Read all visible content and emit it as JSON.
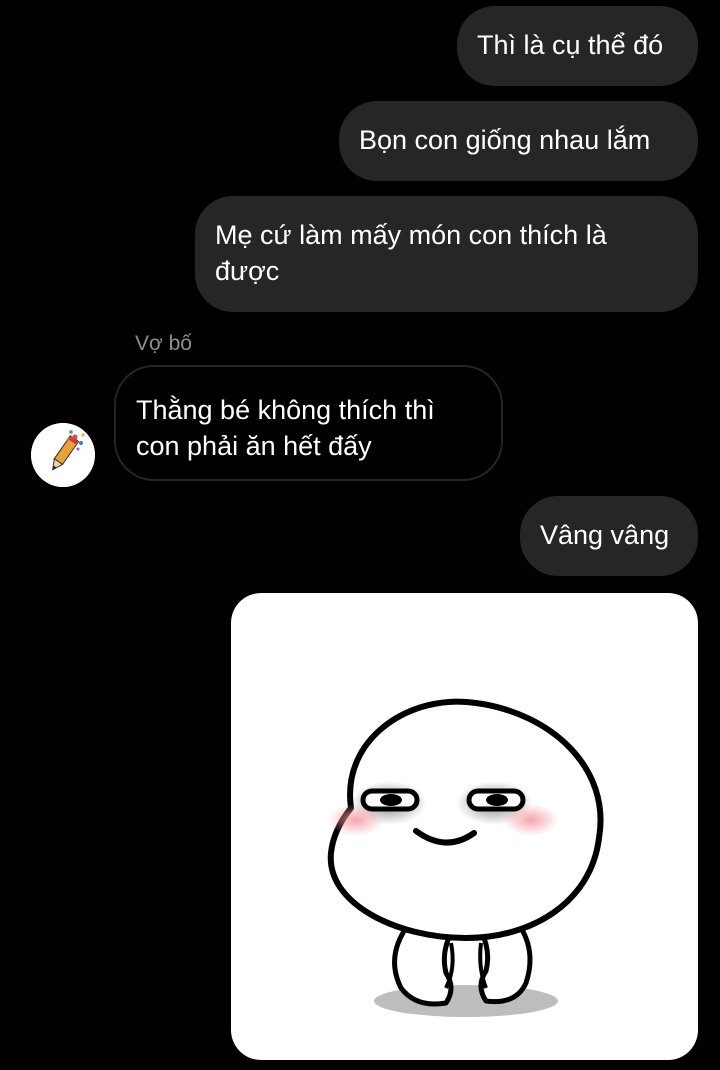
{
  "messages": {
    "outgoing": [
      {
        "text": "Thì là cụ thể đó"
      },
      {
        "text": "Bọn con giống nhau lắm"
      },
      {
        "text": "Mẹ cứ làm mấy món con thích là được"
      },
      {
        "text": "Vâng vâng"
      }
    ],
    "incoming": {
      "sender_name": "Vợ bố",
      "text": "Thằng bé không thích thì con phải ăn hết đấy"
    }
  },
  "colors": {
    "background": "#000000",
    "outgoing_bubble": "#262626",
    "incoming_border": "#262626",
    "text": "#ffffff",
    "sender_name": "#8e8e8e"
  },
  "icons": {
    "avatar": "pencil-drawing-avatar",
    "sticker": "smug-white-blob-sticker"
  }
}
